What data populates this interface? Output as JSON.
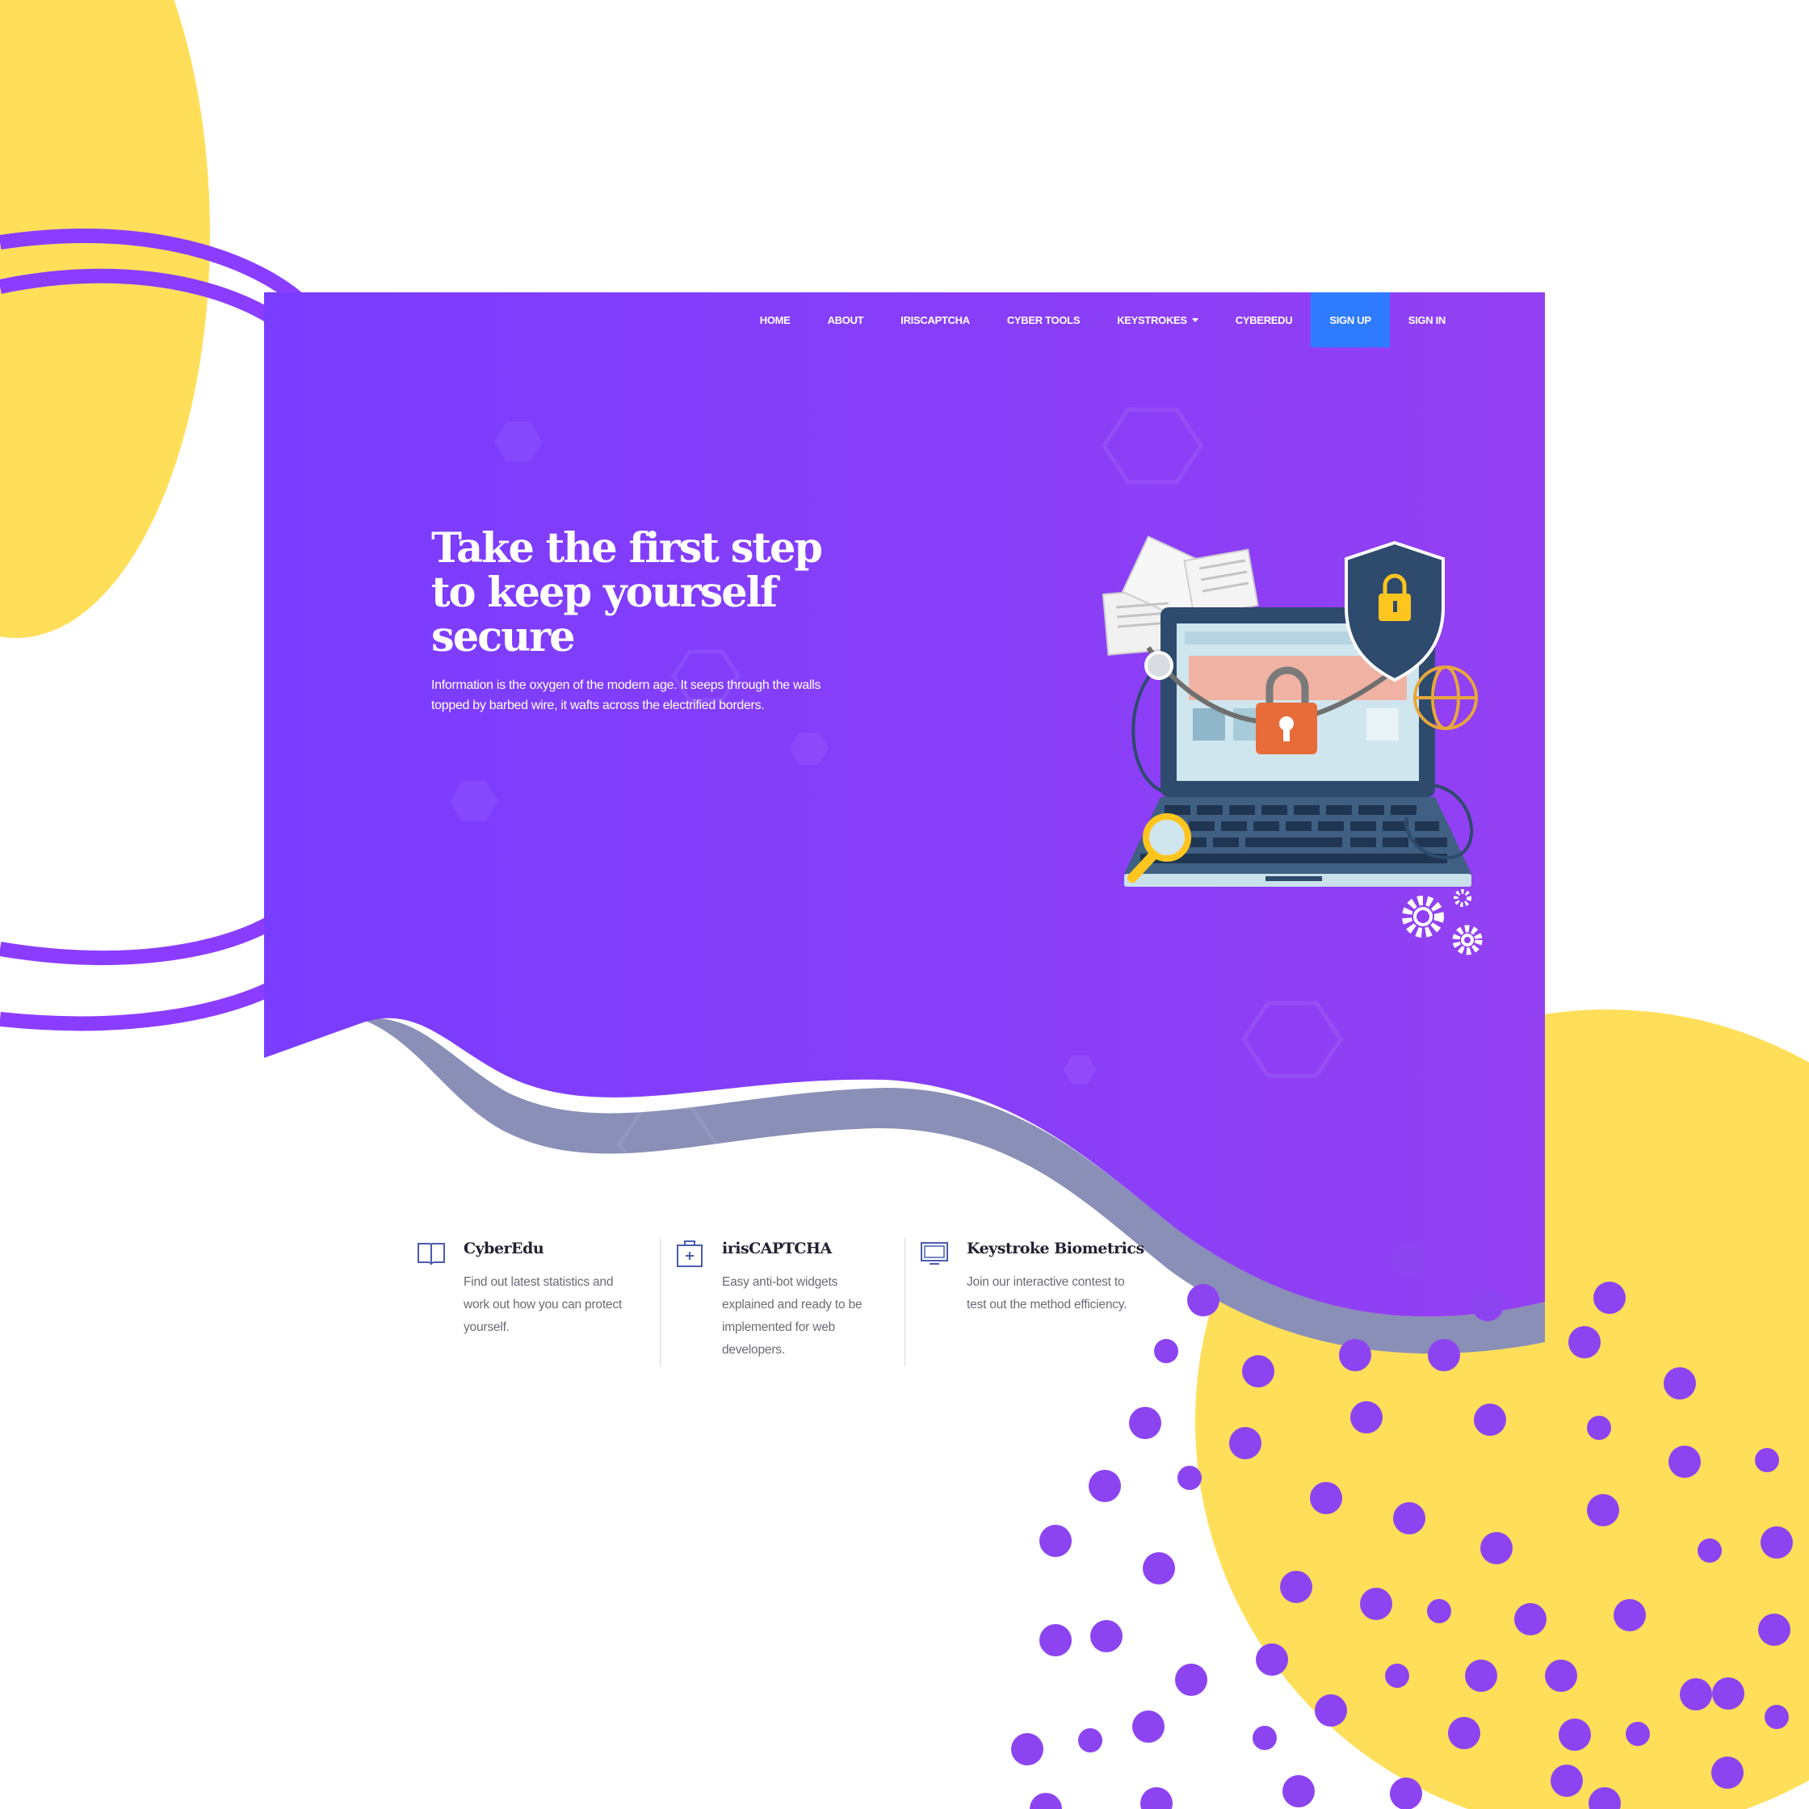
{
  "colors": {
    "accent_purple": "#8b3dff",
    "hero_purple": "#7d3cff",
    "signup_blue": "#2f7bff",
    "decor_yellow": "#ffdf5a",
    "dot_purple": "#8c44f0"
  },
  "nav": {
    "items": [
      "HOME",
      "ABOUT",
      "IRISCAPTCHA",
      "CYBER TOOLS",
      "KEYSTROKES",
      "CYBEREDU",
      "SIGN UP",
      "SIGN IN"
    ]
  },
  "hero": {
    "title_line1": "Take the first step",
    "title_line2": "to keep yourself",
    "title_line3": "secure",
    "text": "Information is the oxygen of the modern age. It seeps through the walls topped by barbed wire, it wafts across the electrified borders.",
    "illustration_icons": [
      "laptop-icon",
      "padlock-icon",
      "shield-icon",
      "chain-icon",
      "magnifier-icon",
      "gears-icon",
      "globe-icon",
      "documents-icon"
    ]
  },
  "features": [
    {
      "icon": "book-icon",
      "title": "CyberEdu",
      "text": "Find out latest statistics and work out how you can protect yourself."
    },
    {
      "icon": "captcha-icon",
      "title": "irisCAPTCHA",
      "text": "Easy anti-bot widgets explained and ready to be implemented for web developers."
    },
    {
      "icon": "monitor-icon",
      "title": "Keystroke Biometrics",
      "text": "Join our interactive contest to test out the method efficiency."
    }
  ]
}
